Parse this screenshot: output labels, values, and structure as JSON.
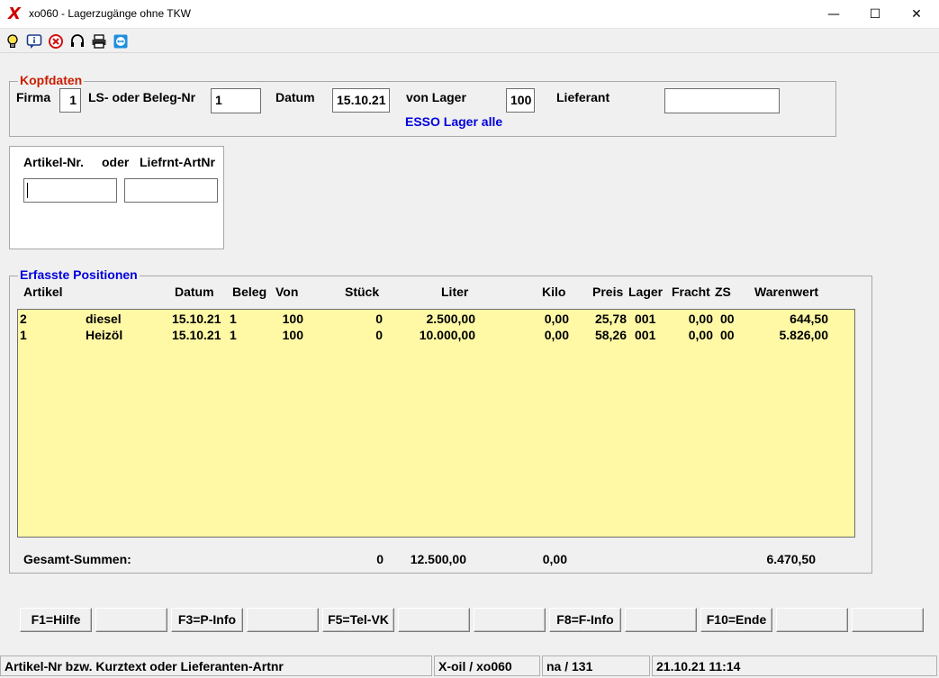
{
  "window": {
    "logo": "X",
    "title": "xo060 - Lagerzugänge ohne TKW",
    "minimize": "—",
    "maximize": "☐",
    "close": "✕"
  },
  "toolbar": {
    "icons": [
      "lightbulb-icon",
      "info-icon",
      "cancel-icon",
      "headset-icon",
      "printer-icon",
      "teamviewer-icon"
    ]
  },
  "kopfdaten": {
    "title": "Kopfdaten",
    "firma_label": "Firma",
    "firma_value": "1",
    "beleg_label": "LS- oder Beleg-Nr",
    "beleg_value": "1",
    "datum_label": "Datum",
    "datum_value": "15.10.21",
    "lager_label": "von Lager",
    "lager_value": "100",
    "lager_name": "ESSO Lager alle",
    "lieferant_label": "Lieferant",
    "lieferant_value": ""
  },
  "artikel_search": {
    "artikel_label": "Artikel-Nr.",
    "oder_label": "oder",
    "liefrnt_label": "Liefrnt-ArtNr",
    "artikel_value": "",
    "liefrnt_value": ""
  },
  "positionen": {
    "title": "Erfasste Positionen",
    "headers": {
      "artikel": "Artikel",
      "datum": "Datum",
      "beleg": "Beleg",
      "von": "Von",
      "stueck": "Stück",
      "liter": "Liter",
      "kilo": "Kilo",
      "preis": "Preis",
      "lager": "Lager",
      "fracht": "Fracht",
      "zs": "ZS",
      "warenwert": "Warenwert"
    },
    "rows": [
      {
        "artikel": "2",
        "name": "diesel",
        "datum": "15.10.21",
        "beleg": "1",
        "von": "100",
        "stueck": "0",
        "liter": "2.500,00",
        "kilo": "0,00",
        "preis": "25,78",
        "lager": "001",
        "fracht": "0,00",
        "zs": "00",
        "warenwert": "644,50"
      },
      {
        "artikel": "1",
        "name": "Heizöl",
        "datum": "15.10.21",
        "beleg": "1",
        "von": "100",
        "stueck": "0",
        "liter": "10.000,00",
        "kilo": "0,00",
        "preis": "58,26",
        "lager": "001",
        "fracht": "0,00",
        "zs": "00",
        "warenwert": "5.826,00"
      }
    ],
    "totals": {
      "label": "Gesamt-Summen:",
      "stueck": "0",
      "liter": "12.500,00",
      "kilo": "0,00",
      "warenwert": "6.470,50"
    }
  },
  "function_keys": [
    "F1=Hilfe",
    "",
    "F3=P-Info",
    "",
    "F5=Tel-VK",
    "",
    "",
    "F8=F-Info",
    "",
    "F10=Ende",
    "",
    ""
  ],
  "statusbar": {
    "hint": "Artikel-Nr bzw. Kurztext oder Lieferanten-Artnr",
    "app": "X-oil / xo060",
    "user": "na / 131",
    "datetime": "21.10.21 11:14"
  },
  "colors": {
    "group_title_red": "#c81e00",
    "group_title_blue": "#0000dd",
    "grid_bg": "#fff9a6",
    "logo_red": "#d00000"
  }
}
